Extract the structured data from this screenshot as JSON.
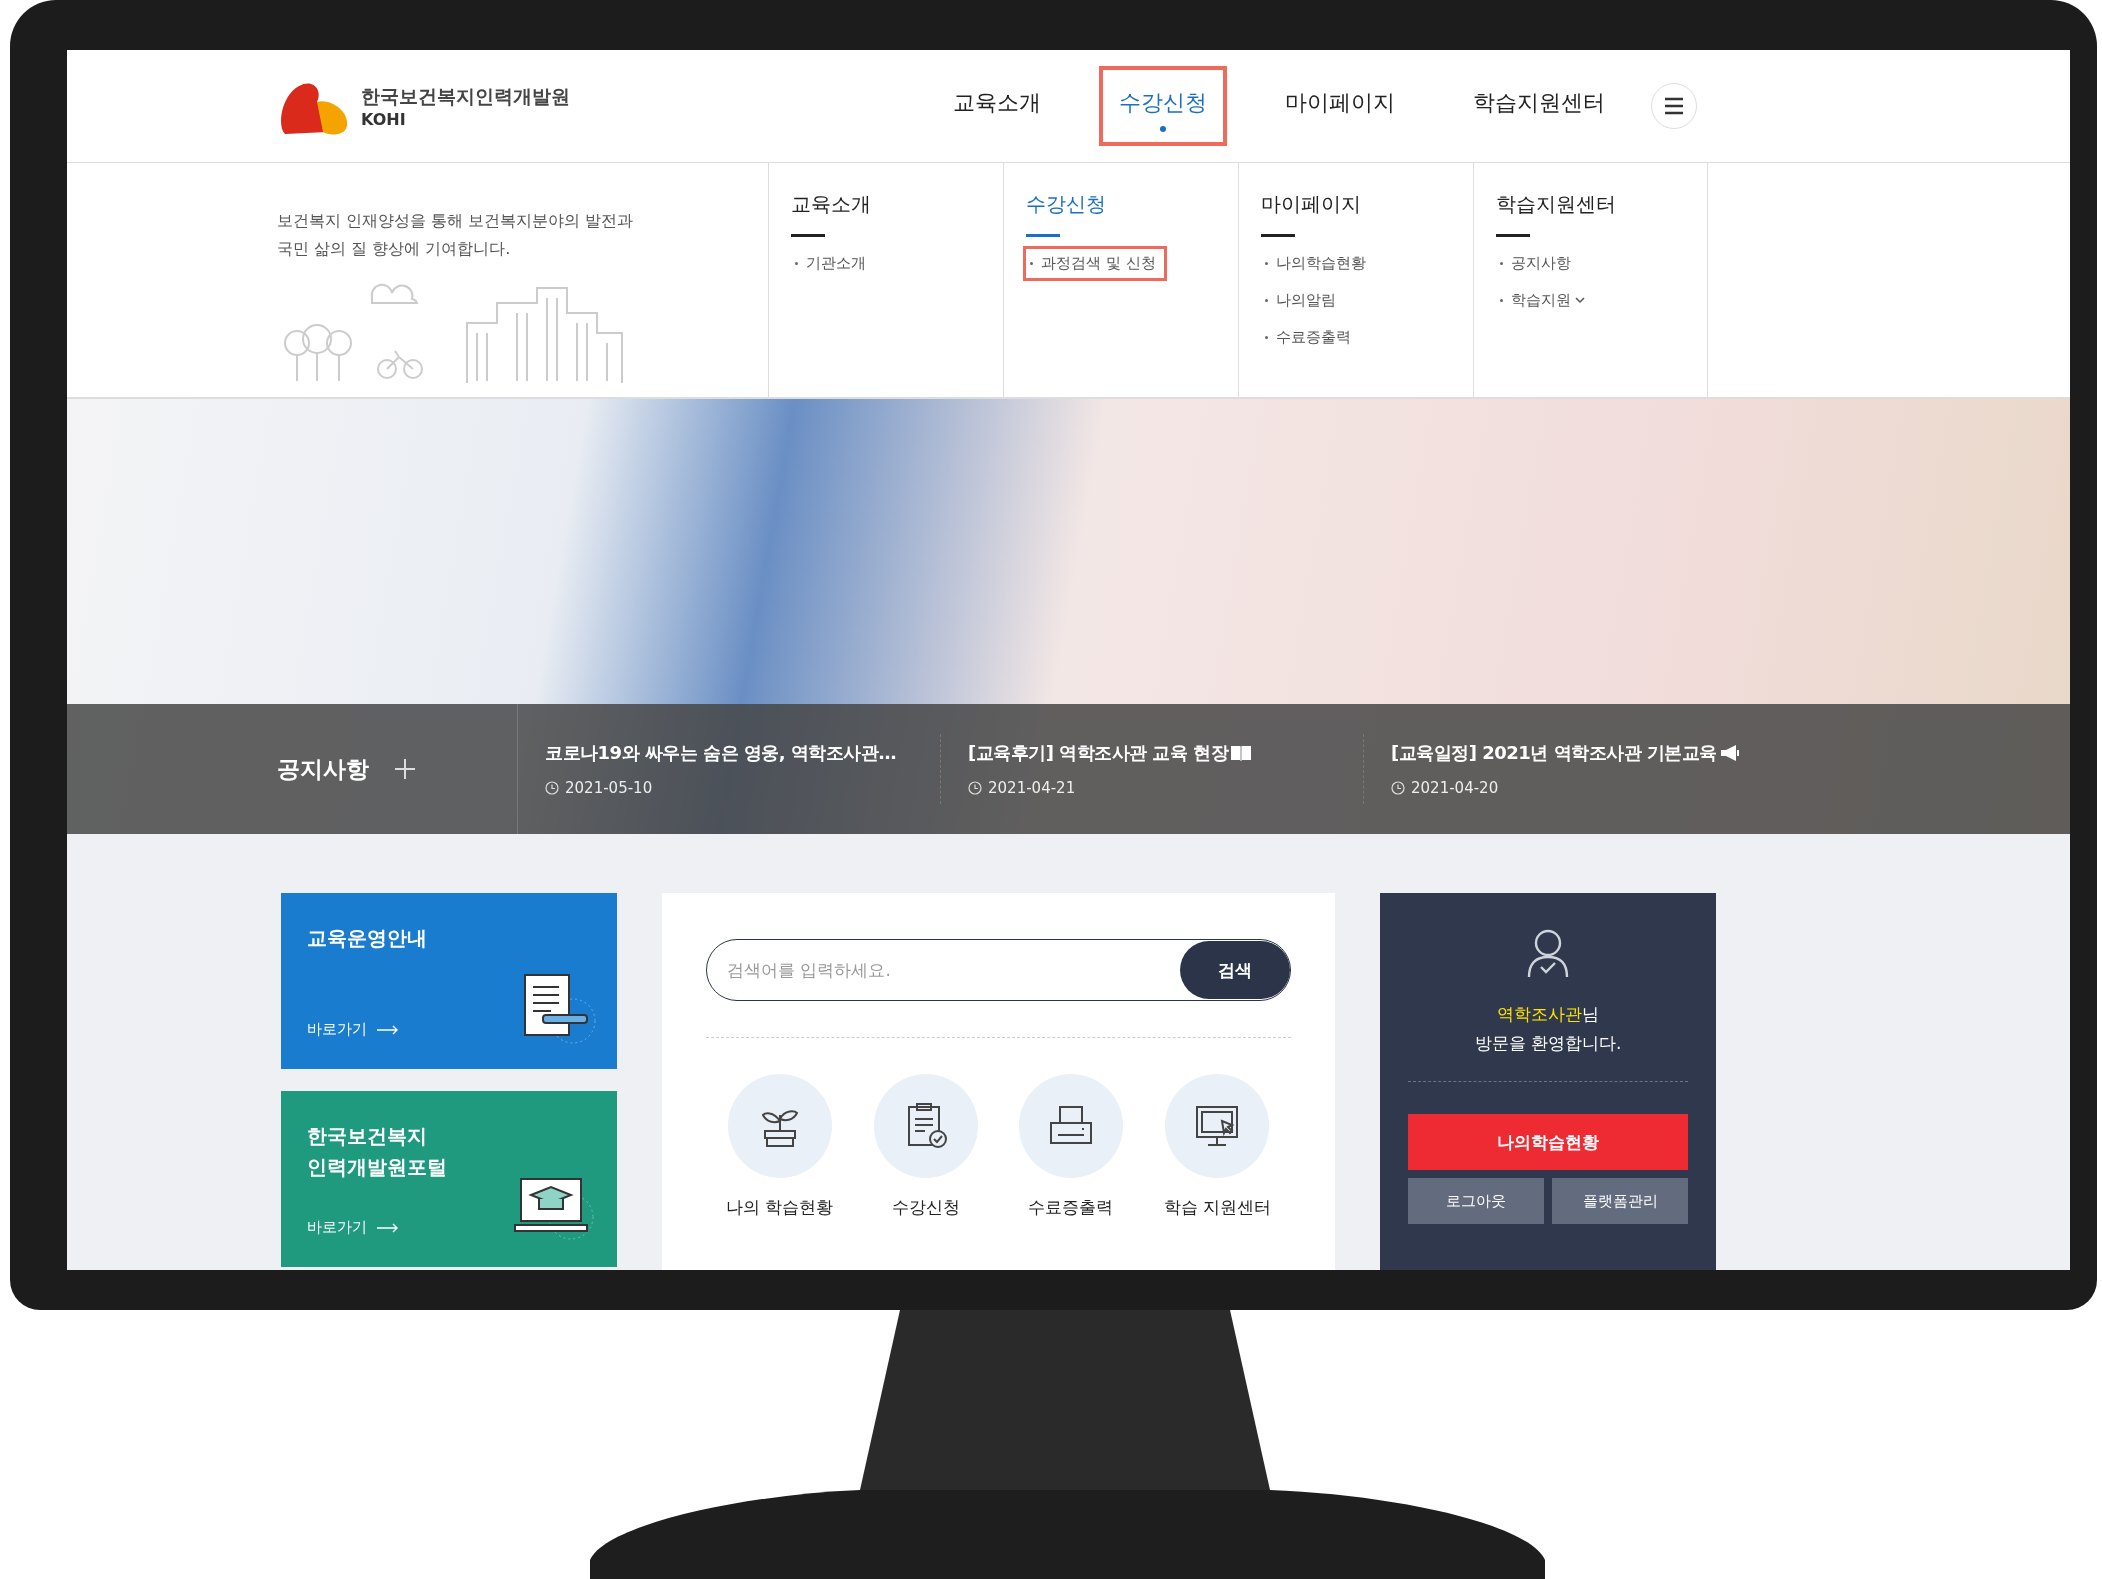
{
  "header": {
    "logo": {
      "name": "한국보건복지인력개발원",
      "abbr": "KOHI"
    },
    "nav": [
      {
        "label": "교육소개",
        "selected": false
      },
      {
        "label": "수강신청",
        "selected": true
      },
      {
        "label": "마이페이지",
        "selected": false
      },
      {
        "label": "학습지원센터",
        "selected": false
      }
    ]
  },
  "mega_menu": {
    "intro": [
      "보건복지 인재양성을 통해 보건복지분야의 발전과",
      "국민 삶의 질 향상에 기여합니다."
    ],
    "columns": [
      {
        "title": "교육소개",
        "selected": false,
        "items": [
          {
            "label": "기관소개",
            "highlighted": false,
            "has_submenu": false
          }
        ]
      },
      {
        "title": "수강신청",
        "selected": true,
        "items": [
          {
            "label": "과정검색 및 신청",
            "highlighted": true,
            "has_submenu": false
          }
        ]
      },
      {
        "title": "마이페이지",
        "selected": false,
        "items": [
          {
            "label": "나의학습현황",
            "highlighted": false,
            "has_submenu": false
          },
          {
            "label": "나의알림",
            "highlighted": false,
            "has_submenu": false
          },
          {
            "label": "수료증출력",
            "highlighted": false,
            "has_submenu": false
          }
        ]
      },
      {
        "title": "학습지원센터",
        "selected": false,
        "items": [
          {
            "label": "공지사항",
            "highlighted": false,
            "has_submenu": false
          },
          {
            "label": "학습지원",
            "highlighted": false,
            "has_submenu": true
          }
        ]
      }
    ]
  },
  "notices": {
    "title": "공지사항",
    "items": [
      {
        "title": "코로나19와 싸우는 숨은 영웅, 역학조사관…",
        "date": "2021-05-10",
        "kind": "plain"
      },
      {
        "title": "[교육후기] 역학조사관 교육 현장",
        "date": "2021-04-21",
        "kind": "book"
      },
      {
        "title": "[교육일정] 2021년 역학조사관 기본교육",
        "date": "2021-04-20",
        "kind": "megaphone"
      }
    ]
  },
  "quick_cards": [
    {
      "title": [
        "교육운영안내"
      ],
      "link": "바로가기",
      "color": "#1a7ccf",
      "kind": "document"
    },
    {
      "title": [
        "한국보건복지",
        "인력개발원포털"
      ],
      "link": "바로가기",
      "color": "#1f9a7e",
      "kind": "laptop"
    }
  ],
  "search": {
    "placeholder": "검색어를 입력하세요.",
    "button": "검색"
  },
  "quick_links": [
    {
      "label": "나의 학습현황",
      "kind": "plant"
    },
    {
      "label": "수강신청",
      "kind": "document"
    },
    {
      "label": "수료증출력",
      "kind": "printer"
    },
    {
      "label": "학습 지원센터",
      "kind": "monitor"
    }
  ],
  "user_panel": {
    "name": "역학조사관",
    "suffix": "님",
    "welcome": "방문을 환영합니다.",
    "primary_button": "나의학습현황",
    "buttons": [
      "로그아웃",
      "플랫폼관리"
    ]
  }
}
